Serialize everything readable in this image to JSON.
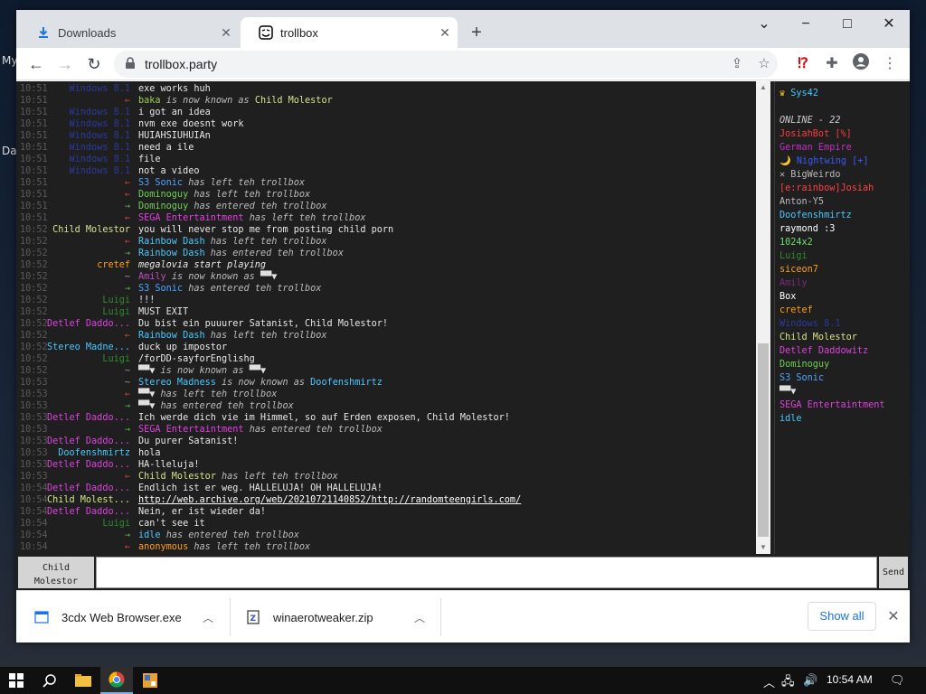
{
  "desktop": {
    "label_1": "My",
    "label_2": "Da"
  },
  "window": {
    "tabs": [
      {
        "label": "Downloads",
        "icon": "download-icon",
        "active": false
      },
      {
        "label": "trollbox",
        "icon": "trollface-icon",
        "active": true
      }
    ],
    "controls": {
      "minimize": "−",
      "maximize": "□",
      "close": "✕",
      "tabsearch": "⌄"
    }
  },
  "toolbar": {
    "url": "trollbox.party"
  },
  "chat": {
    "messages": [
      {
        "time": "10:51",
        "nick": "Windows 8.1",
        "nick_color": "#2a3a9e",
        "text": "exe works huh",
        "kind": "msg"
      },
      {
        "time": "10:51",
        "nick": "←",
        "nick_color": "#e04444",
        "text": "baka",
        "text_color": "#9ccc5a",
        "tail": "is now known as",
        "tail2": "Child Molestor",
        "tail2_color": "#d9e28c",
        "kind": "rename"
      },
      {
        "time": "10:51",
        "nick": "Windows 8.1",
        "nick_color": "#2a3a9e",
        "text": "i got an idea",
        "kind": "msg"
      },
      {
        "time": "10:51",
        "nick": "Windows 8.1",
        "nick_color": "#2a3a9e",
        "text": "nvm exe doesnt work",
        "kind": "msg"
      },
      {
        "time": "10:51",
        "nick": "Windows 8.1",
        "nick_color": "#2a3a9e",
        "text": "HUIAHSIUHUIAn",
        "kind": "msg"
      },
      {
        "time": "10:51",
        "nick": "Windows 8.1",
        "nick_color": "#2a3a9e",
        "text": "need a ile",
        "kind": "msg"
      },
      {
        "time": "10:51",
        "nick": "Windows 8.1",
        "nick_color": "#2a3a9e",
        "text": "file",
        "kind": "msg"
      },
      {
        "time": "10:51",
        "nick": "Windows 8.1",
        "nick_color": "#2a3a9e",
        "text": "not a video",
        "kind": "msg"
      },
      {
        "time": "10:51",
        "nick": "←",
        "nick_color": "#e04444",
        "text": "S3 Sonic",
        "text_color": "#4aa3ff",
        "tail": "has left teh trollbox",
        "kind": "sys"
      },
      {
        "time": "10:51",
        "nick": "←",
        "nick_color": "#e04444",
        "text": "Dominoguy",
        "text_color": "#6fcf55",
        "tail": "has left teh trollbox",
        "kind": "sys"
      },
      {
        "time": "10:51",
        "nick": "→",
        "nick_color": "#58c04a",
        "text": "Dominoguy",
        "text_color": "#6fcf55",
        "tail": "has entered teh trollbox",
        "kind": "sys"
      },
      {
        "time": "10:51",
        "nick": "←",
        "nick_color": "#e04444",
        "text": "SEGA Entertaintment",
        "text_color": "#e040e0",
        "tail": "has left teh trollbox",
        "kind": "sys"
      },
      {
        "time": "10:52",
        "nick": "Child Molestor",
        "nick_color": "#d9e28c",
        "text": "you will never stop me from posting child porn",
        "kind": "msg"
      },
      {
        "time": "10:52",
        "nick": "←",
        "nick_color": "#e04444",
        "text": "Rainbow Dash",
        "text_color": "#4ac7ff",
        "tail": "has left teh trollbox",
        "kind": "sys"
      },
      {
        "time": "10:52",
        "nick": "→",
        "nick_color": "#58c04a",
        "text": "Rainbow Dash",
        "text_color": "#4ac7ff",
        "tail": "has entered teh trollbox",
        "kind": "sys"
      },
      {
        "time": "10:52",
        "nick": "cretef",
        "nick_color": "#ff9f1a",
        "text": "megalovia start playing",
        "kind": "msg_italic"
      },
      {
        "time": "10:52",
        "nick": "~",
        "nick_color": "#999999",
        "text": "Amily",
        "text_color": "#c04ac0",
        "tail": "is now known as",
        "tail2": "▀▀▼",
        "tail2_color": "#e0e0e0",
        "kind": "rename"
      },
      {
        "time": "10:52",
        "nick": "→",
        "nick_color": "#58c04a",
        "text": "S3 Sonic",
        "text_color": "#4aa3ff",
        "tail": "has entered teh trollbox",
        "kind": "sys"
      },
      {
        "time": "10:52",
        "nick": "Luigi",
        "nick_color": "#2e8b2e",
        "text": "!!!",
        "kind": "msg"
      },
      {
        "time": "10:52",
        "nick": "Luigi",
        "nick_color": "#2e8b2e",
        "text": "MUST EXIT",
        "kind": "msg"
      },
      {
        "time": "10:52",
        "nick": "Detlef Daddo...",
        "nick_color": "#e040e0",
        "text": "Du bist ein puuurer Satanist, Child Molestor!",
        "kind": "msg"
      },
      {
        "time": "10:52",
        "nick": "←",
        "nick_color": "#e04444",
        "text": "Rainbow Dash",
        "text_color": "#4ac7ff",
        "tail": "has left teh trollbox",
        "kind": "sys"
      },
      {
        "time": "10:52",
        "nick": "Stereo Madne...",
        "nick_color": "#4ac7ff",
        "text": "duck up impostor",
        "kind": "msg"
      },
      {
        "time": "10:52",
        "nick": "Luigi",
        "nick_color": "#2e8b2e",
        "text": "/forDD-sayforEnglishg",
        "kind": "msg"
      },
      {
        "time": "10:52",
        "nick": "~",
        "nick_color": "#999999",
        "text": "▀▀▼",
        "text_color": "#e0e0e0",
        "tail": "is now known as",
        "tail2": "▀▀▼",
        "tail2_color": "#e0e0e0",
        "kind": "rename"
      },
      {
        "time": "10:53",
        "nick": "~",
        "nick_color": "#999999",
        "text": "Stereo Madness",
        "text_color": "#4ac7ff",
        "tail": "is now known as",
        "tail2": "Doofenshmirtz",
        "tail2_color": "#4ac7ff",
        "kind": "rename"
      },
      {
        "time": "10:53",
        "nick": "←",
        "nick_color": "#e04444",
        "text": "▀▀▼",
        "text_color": "#e0e0e0",
        "tail": "has left teh trollbox",
        "kind": "sys"
      },
      {
        "time": "10:53",
        "nick": "→",
        "nick_color": "#58c04a",
        "text": "▀▀▼",
        "text_color": "#e0e0e0",
        "tail": "has entered teh trollbox",
        "kind": "sys"
      },
      {
        "time": "10:53",
        "nick": "Detlef Daddo...",
        "nick_color": "#e040e0",
        "text": "Ich werde dich vie im Himmel, so auf Erden exposen, Child Molestor!",
        "kind": "msg"
      },
      {
        "time": "10:53",
        "nick": "→",
        "nick_color": "#58c04a",
        "text": "SEGA Entertaintment",
        "text_color": "#e040e0",
        "tail": "has entered teh trollbox",
        "kind": "sys"
      },
      {
        "time": "10:53",
        "nick": "Detlef Daddo...",
        "nick_color": "#e040e0",
        "text": "Du purer Satanist!",
        "kind": "msg"
      },
      {
        "time": "10:53",
        "nick": "Doofenshmirtz",
        "nick_color": "#4ac7ff",
        "text": "hola",
        "kind": "msg"
      },
      {
        "time": "10:53",
        "nick": "Detlef Daddo...",
        "nick_color": "#e040e0",
        "text": "HA-lleluja!",
        "kind": "msg"
      },
      {
        "time": "10:53",
        "nick": "←",
        "nick_color": "#e04444",
        "text": "Child Molestor",
        "text_color": "#d9e28c",
        "tail": "has left teh trollbox",
        "kind": "sys"
      },
      {
        "time": "10:54",
        "nick": "Detlef Daddo...",
        "nick_color": "#e040e0",
        "text": "Endlich ist er weg. HALLELUJA! OH HALLELUJA!",
        "kind": "msg"
      },
      {
        "time": "10:54",
        "nick": "Child Molest...",
        "nick_color": "#d9e28c",
        "text": "http://web.archive.org/web/20210721140852/http://randomteengirls.com/",
        "kind": "link"
      },
      {
        "time": "10:54",
        "nick": "Detlef Daddo...",
        "nick_color": "#e040e0",
        "text": "Nein, er ist wieder da!",
        "kind": "msg"
      },
      {
        "time": "10:54",
        "nick": "Luigi",
        "nick_color": "#2e8b2e",
        "text": "can't see it",
        "kind": "msg"
      },
      {
        "time": "10:54",
        "nick": "→",
        "nick_color": "#58c04a",
        "text": "idle",
        "text_color": "#4ac7ff",
        "tail": "has entered teh trollbox",
        "kind": "sys"
      },
      {
        "time": "10:54",
        "nick": "←",
        "nick_color": "#e04444",
        "text": "anonymous",
        "text_color": "#ff9f1a",
        "tail": "has left teh trollbox",
        "kind": "sys"
      }
    ]
  },
  "userlist": {
    "owner": "Sys42",
    "owner_icon": "crown-icon",
    "online_label": "ONLINE - 22",
    "users": [
      {
        "name": "JosiahBot [%]",
        "color": "#ff3b3b"
      },
      {
        "name": "German Empire",
        "color": "#c030c0"
      },
      {
        "name": "🌙 Nightwing [+]",
        "color": "#3a5bff"
      },
      {
        "name": "✕ BigWeirdo",
        "color": "#bbbbbb"
      },
      {
        "name": "[e:rainbow]Josiah",
        "color": "#ff4040"
      },
      {
        "name": "Anton-Y5",
        "color": "#bbbbbb"
      },
      {
        "name": "Doofenshmirtz",
        "color": "#4ac7ff"
      },
      {
        "name": "raymond :3",
        "color": "#ffffff"
      },
      {
        "name": "1024x2",
        "color": "#6fe06f"
      },
      {
        "name": "Luigi",
        "color": "#2e8b2e"
      },
      {
        "name": "siceon7",
        "color": "#ff9f1a"
      },
      {
        "name": "Amily",
        "color": "#7a2a7a"
      },
      {
        "name": "Box",
        "color": "#ffffff"
      },
      {
        "name": "cretef",
        "color": "#ff9f1a"
      },
      {
        "name": "Windows 8.1",
        "color": "#2a3a9e"
      },
      {
        "name": "Child Molestor",
        "color": "#d9e28c"
      },
      {
        "name": "Detlef Daddowitz",
        "color": "#e040e0"
      },
      {
        "name": "Dominoguy",
        "color": "#6fcf55"
      },
      {
        "name": "S3 Sonic",
        "color": "#4aa3ff"
      },
      {
        "name": "▀▀▼",
        "color": "#e0e0e0"
      },
      {
        "name": "SEGA Entertaintment",
        "color": "#e040e0"
      },
      {
        "name": "idle",
        "color": "#4ac7ff"
      }
    ]
  },
  "input": {
    "nick_line1": "Child",
    "nick_line2": "Molestor",
    "send_label": "Send",
    "value": ""
  },
  "downloads": {
    "items": [
      {
        "name": "3cdx Web Browser.exe",
        "icon": "exe-file-icon"
      },
      {
        "name": "winaerotweaker.zip",
        "icon": "zip-file-icon"
      }
    ],
    "show_all": "Show all"
  },
  "taskbar": {
    "time": "10:54 AM"
  }
}
